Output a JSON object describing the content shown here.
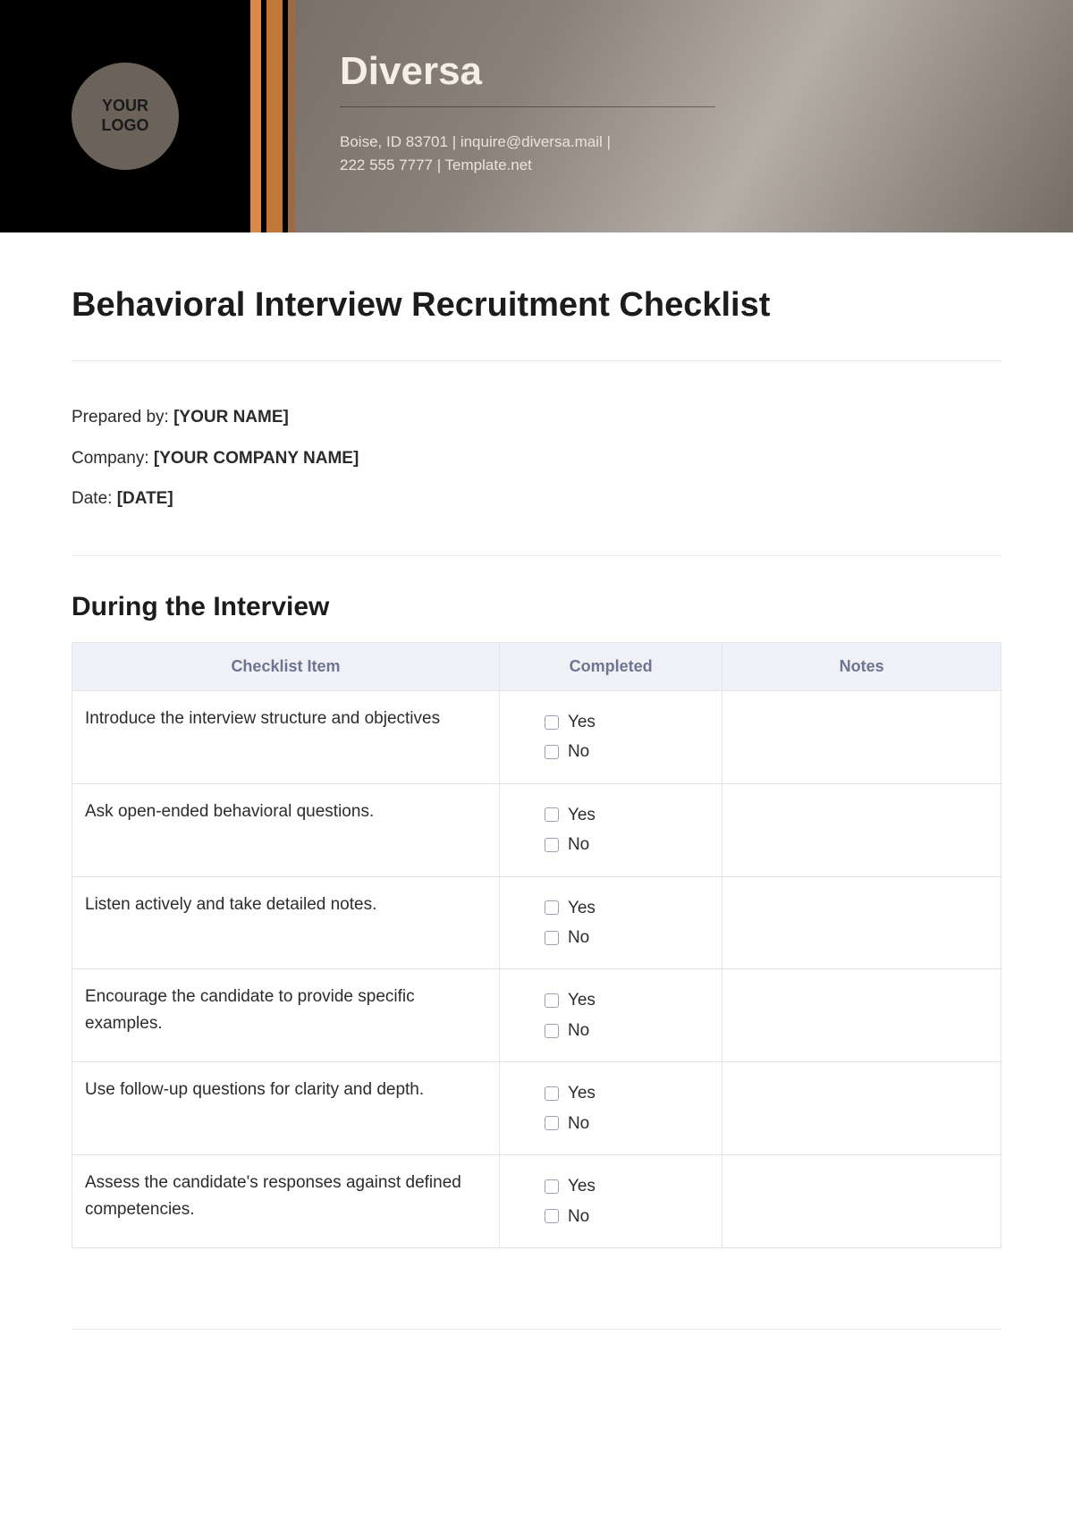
{
  "header": {
    "logo_line1": "YOUR",
    "logo_line2": "LOGO",
    "brand": "Diversa",
    "contact_line1": "Boise, ID 83701 | inquire@diversa.mail |",
    "contact_line2": "222 555 7777 | Template.net"
  },
  "title": "Behavioral Interview Recruitment Checklist",
  "meta": {
    "prepared_label": "Prepared by: ",
    "prepared_value": "[YOUR NAME]",
    "company_label": "Company: ",
    "company_value": "[YOUR COMPANY NAME]",
    "date_label": "Date: ",
    "date_value": "[DATE]"
  },
  "section_title": "During the Interview",
  "table": {
    "headers": {
      "item": "Checklist Item",
      "completed": "Completed",
      "notes": "Notes"
    },
    "options": {
      "yes": "Yes",
      "no": "No"
    },
    "rows": [
      {
        "item": "Introduce the interview structure and objectives",
        "notes": ""
      },
      {
        "item": "Ask open-ended behavioral questions.",
        "notes": ""
      },
      {
        "item": "Listen actively and take detailed notes.",
        "notes": ""
      },
      {
        "item": "Encourage the candidate to provide specific examples.",
        "notes": ""
      },
      {
        "item": "Use follow-up questions for clarity and depth.",
        "notes": ""
      },
      {
        "item": "Assess the candidate's responses against defined competencies.",
        "notes": ""
      }
    ]
  }
}
